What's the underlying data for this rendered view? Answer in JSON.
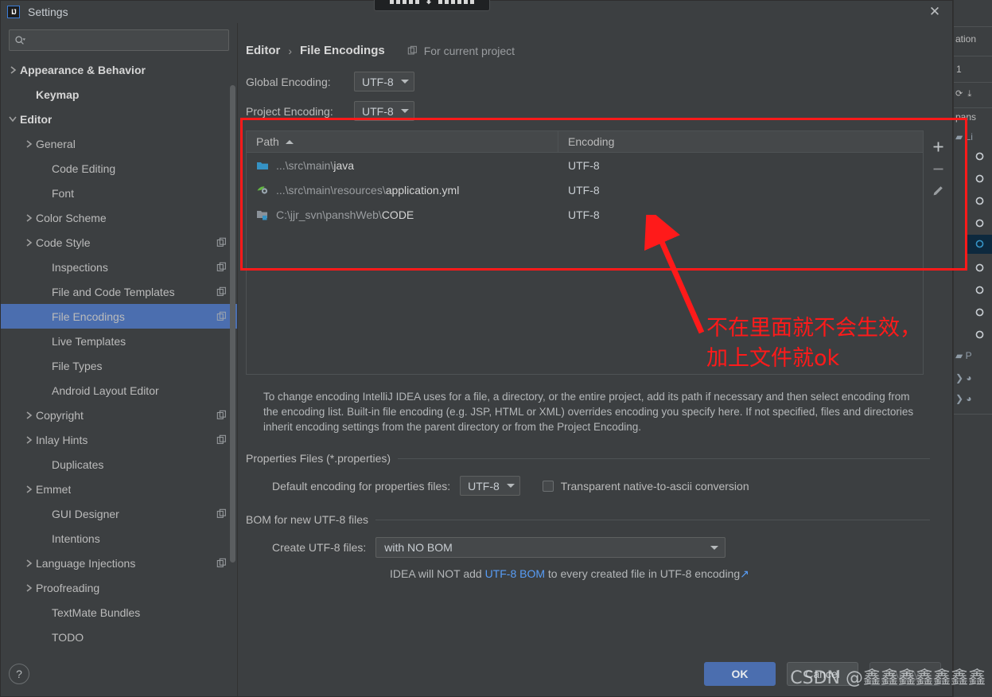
{
  "window": {
    "title": "Settings",
    "app_icon_label": "IJ",
    "close_icon": "close-icon"
  },
  "sidebar": {
    "search": {
      "value": "",
      "placeholder": ""
    },
    "items": [
      {
        "label": "Appearance & Behavior",
        "chevron": "collapsed",
        "indent": 0,
        "bold": true,
        "scope_icon": false,
        "selected": false
      },
      {
        "label": "Keymap",
        "chevron": "none",
        "indent": 1,
        "bold": true,
        "scope_icon": false,
        "selected": false
      },
      {
        "label": "Editor",
        "chevron": "expanded",
        "indent": 0,
        "bold": true,
        "scope_icon": false,
        "selected": false
      },
      {
        "label": "General",
        "chevron": "collapsed",
        "indent": 1,
        "bold": false,
        "scope_icon": false,
        "selected": false
      },
      {
        "label": "Code Editing",
        "chevron": "none",
        "indent": 2,
        "bold": false,
        "scope_icon": false,
        "selected": false
      },
      {
        "label": "Font",
        "chevron": "none",
        "indent": 2,
        "bold": false,
        "scope_icon": false,
        "selected": false
      },
      {
        "label": "Color Scheme",
        "chevron": "collapsed",
        "indent": 1,
        "bold": false,
        "scope_icon": false,
        "selected": false
      },
      {
        "label": "Code Style",
        "chevron": "collapsed",
        "indent": 1,
        "bold": false,
        "scope_icon": true,
        "selected": false
      },
      {
        "label": "Inspections",
        "chevron": "none",
        "indent": 2,
        "bold": false,
        "scope_icon": true,
        "selected": false
      },
      {
        "label": "File and Code Templates",
        "chevron": "none",
        "indent": 2,
        "bold": false,
        "scope_icon": true,
        "selected": false
      },
      {
        "label": "File Encodings",
        "chevron": "none",
        "indent": 2,
        "bold": false,
        "scope_icon": true,
        "selected": true
      },
      {
        "label": "Live Templates",
        "chevron": "none",
        "indent": 2,
        "bold": false,
        "scope_icon": false,
        "selected": false
      },
      {
        "label": "File Types",
        "chevron": "none",
        "indent": 2,
        "bold": false,
        "scope_icon": false,
        "selected": false
      },
      {
        "label": "Android Layout Editor",
        "chevron": "none",
        "indent": 2,
        "bold": false,
        "scope_icon": false,
        "selected": false
      },
      {
        "label": "Copyright",
        "chevron": "collapsed",
        "indent": 1,
        "bold": false,
        "scope_icon": true,
        "selected": false
      },
      {
        "label": "Inlay Hints",
        "chevron": "collapsed",
        "indent": 1,
        "bold": false,
        "scope_icon": true,
        "selected": false
      },
      {
        "label": "Duplicates",
        "chevron": "none",
        "indent": 2,
        "bold": false,
        "scope_icon": false,
        "selected": false
      },
      {
        "label": "Emmet",
        "chevron": "collapsed",
        "indent": 1,
        "bold": false,
        "scope_icon": false,
        "selected": false
      },
      {
        "label": "GUI Designer",
        "chevron": "none",
        "indent": 2,
        "bold": false,
        "scope_icon": true,
        "selected": false
      },
      {
        "label": "Intentions",
        "chevron": "none",
        "indent": 2,
        "bold": false,
        "scope_icon": false,
        "selected": false
      },
      {
        "label": "Language Injections",
        "chevron": "collapsed",
        "indent": 1,
        "bold": false,
        "scope_icon": true,
        "selected": false
      },
      {
        "label": "Proofreading",
        "chevron": "collapsed",
        "indent": 1,
        "bold": false,
        "scope_icon": false,
        "selected": false
      },
      {
        "label": "TextMate Bundles",
        "chevron": "none",
        "indent": 2,
        "bold": false,
        "scope_icon": false,
        "selected": false
      },
      {
        "label": "TODO",
        "chevron": "none",
        "indent": 2,
        "bold": false,
        "scope_icon": false,
        "selected": false
      }
    ],
    "help_label": "?"
  },
  "main": {
    "breadcrumb": {
      "parent": "Editor",
      "separator": "›",
      "current": "File Encodings"
    },
    "scope_note": "For current project",
    "global_encoding": {
      "label": "Global Encoding:",
      "value": "UTF-8"
    },
    "project_encoding": {
      "label": "Project Encoding:",
      "value": "UTF-8"
    },
    "table": {
      "columns": [
        "Path",
        "Encoding"
      ],
      "sort_column": "Path",
      "sort_direction": "asc",
      "rows": [
        {
          "icon": "folder-icon",
          "path_prefix": "...\\src\\main\\",
          "path_name": "java",
          "encoding": "UTF-8"
        },
        {
          "icon": "yaml-file-icon",
          "path_prefix": "...\\src\\main\\resources\\",
          "path_name": "application.yml",
          "encoding": "UTF-8"
        },
        {
          "icon": "module-folder-icon",
          "path_prefix": "C:\\jjr_svn\\panshWeb\\",
          "path_name": "CODE",
          "encoding": "UTF-8"
        }
      ],
      "tools": [
        {
          "name": "add-button",
          "glyph": "+"
        },
        {
          "name": "remove-button",
          "glyph": "−"
        },
        {
          "name": "edit-button",
          "glyph": "pencil"
        }
      ]
    },
    "description": "To change encoding IntelliJ IDEA uses for a file, a directory, or the entire project, add its path if necessary and then select encoding from the encoding list. Built-in file encoding (e.g. JSP, HTML or XML) overrides encoding you specify here. If not specified, files and directories inherit encoding settings from the parent directory or from the Project Encoding.",
    "properties_section": {
      "title": "Properties Files (*.properties)",
      "default_encoding_label": "Default encoding for properties files:",
      "default_encoding_value": "UTF-8",
      "checkbox_label": "Transparent native-to-ascii conversion",
      "checkbox_checked": false
    },
    "bom_section": {
      "title": "BOM for new UTF-8 files",
      "create_label": "Create UTF-8 files:",
      "create_value": "with NO BOM",
      "note_before": "IDEA will NOT add ",
      "note_link": "UTF-8 BOM",
      "note_after": " to every created file in UTF-8 encoding",
      "note_ext_icon": "↗"
    }
  },
  "footer": {
    "ok": "OK",
    "cancel": "Cancel",
    "apply": "Apply"
  },
  "annotations": {
    "highlight_box": "red-rectangle-around-encoding-table",
    "arrow": "red-arrow-pointing-to-table",
    "text": "不在里面就不会生效，\n加上文件就ok",
    "color": "#ff1a1a"
  },
  "watermark": "CSDN @鑫鑫鑫鑫鑫鑫鑫",
  "background_ide": {
    "fragments": [
      "ation",
      "1",
      "pans",
      "Li",
      "P"
    ]
  },
  "colors": {
    "dialog_bg": "#3c3f41",
    "selection": "#4b6eaf",
    "text": "#bbbbbb",
    "link": "#589df6",
    "accent_red": "#ff1a1a"
  }
}
